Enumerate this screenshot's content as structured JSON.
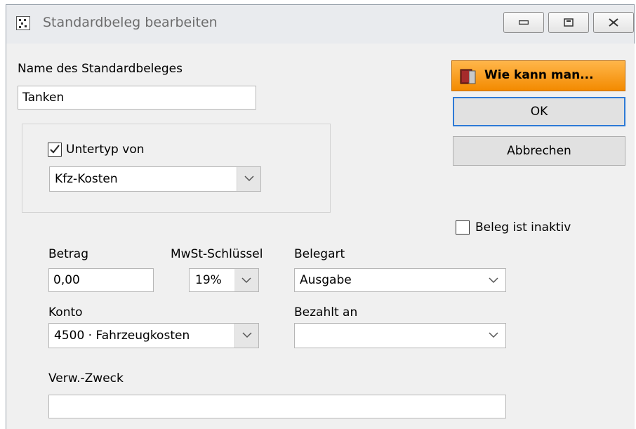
{
  "window": {
    "title": "Standardbeleg bearbeiten",
    "controls": [
      "minimize-icon",
      "maximize-icon",
      "close-icon"
    ]
  },
  "form": {
    "name_label": "Name des Standardbeleges",
    "name_value": "Tanken",
    "subtype_label": "Untertyp von",
    "subtype_checked": true,
    "subtype_value": "Kfz-Kosten",
    "inactive_label": "Beleg ist inaktiv",
    "inactive_checked": false,
    "amount_label": "Betrag",
    "amount_value": "0,00",
    "vat_label": "MwSt-Schlüssel",
    "vat_value": "19%",
    "type_label": "Belegart",
    "type_value": "Ausgabe",
    "account_label": "Konto",
    "account_value": "4500 · Fahrzeugkosten",
    "paid_to_label": "Bezahlt an",
    "paid_to_value": "",
    "purpose_label": "Verw.-Zweck",
    "purpose_value": ""
  },
  "buttons": {
    "help": "Wie kann man...",
    "ok": "OK",
    "cancel": "Abbrechen"
  },
  "colors": {
    "help_button": "#f38a00",
    "default_button_border": "#2d7ad6",
    "dialog_background": "#f0f0f0"
  }
}
